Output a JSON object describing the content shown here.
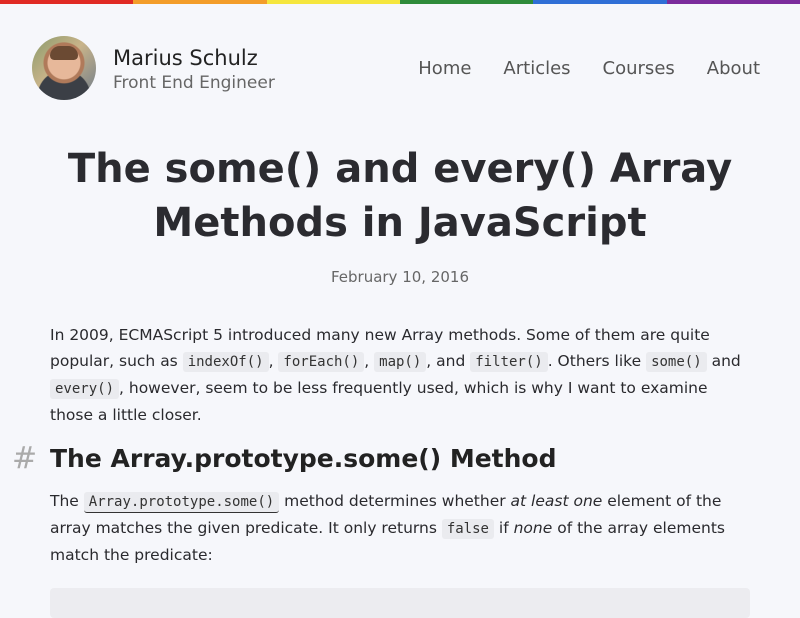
{
  "rainbow_colors": [
    "#e02a24",
    "#f39d2a",
    "#f5e63d",
    "#2e8b3a",
    "#2f6fd6",
    "#7b2c9c"
  ],
  "header": {
    "site_name": "Marius Schulz",
    "site_subtitle": "Front End Engineer",
    "nav": [
      "Home",
      "Articles",
      "Courses",
      "About"
    ]
  },
  "article": {
    "title": "The some() and every() Array Methods in JavaScript",
    "date": "February 10, 2016",
    "intro": {
      "t1": "In 2009, ECMAScript 5 introduced many new Array methods. Some of them are quite popular, such as ",
      "c1": "indexOf()",
      "t2": ", ",
      "c2": "forEach()",
      "t3": ", ",
      "c3": "map()",
      "t4": ", and ",
      "c4": "filter()",
      "t5": ". Others like ",
      "c5": "some()",
      "t6": " and ",
      "c6": "every()",
      "t7": ", however, seem to be less frequently used, which is why I want to examine those a little closer."
    },
    "section": {
      "anchor": "#",
      "heading": "The Array.prototype.some() Method",
      "p": {
        "t1": "The ",
        "c1": "Array.prototype.some()",
        "t2": " method determines whether ",
        "em1": "at least one",
        "t3": " element of the array matches the given predicate. It only returns ",
        "c2": "false",
        "t4": " if ",
        "em2": "none",
        "t5": " of the array elements match the predicate:"
      }
    }
  }
}
